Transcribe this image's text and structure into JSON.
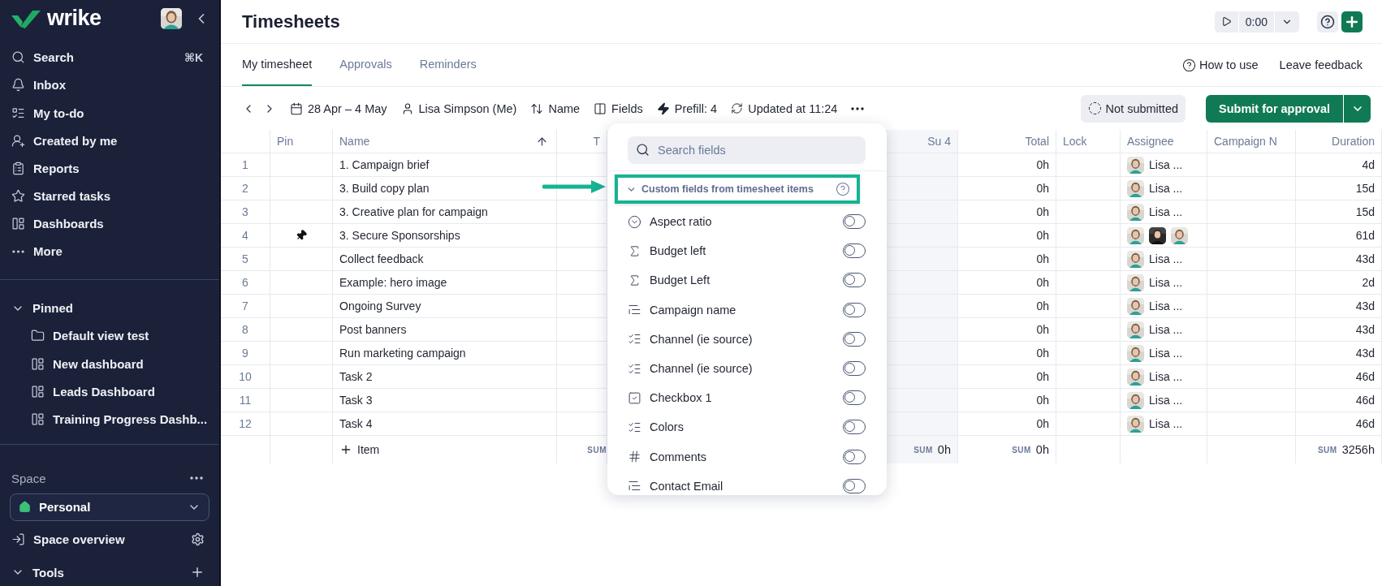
{
  "sidebar": {
    "logo": "wrike",
    "nav": [
      {
        "kind": "search",
        "label": "Search",
        "shortcut": "⌘K"
      },
      {
        "kind": "inbox",
        "label": "Inbox"
      },
      {
        "kind": "todo",
        "label": "My to-do"
      },
      {
        "kind": "created",
        "label": "Created by me"
      },
      {
        "kind": "reports",
        "label": "Reports"
      },
      {
        "kind": "starred",
        "label": "Starred tasks"
      },
      {
        "kind": "dashboards",
        "label": "Dashboards"
      },
      {
        "kind": "more",
        "label": "More"
      }
    ],
    "pinned": {
      "title": "Pinned",
      "expanded": true,
      "items": [
        {
          "kind": "folder",
          "label": "Default view test"
        },
        {
          "kind": "dashboard",
          "label": "New dashboard"
        },
        {
          "kind": "dashboard",
          "label": "Leads Dashboard"
        },
        {
          "kind": "dashboard",
          "label": "Training Progress Dashb..."
        }
      ]
    },
    "space": {
      "title": "Space",
      "selector": "Personal",
      "overview": "Space overview"
    },
    "tools": {
      "title": "Tools",
      "expanded": true
    }
  },
  "header": {
    "title": "Timesheets",
    "timer": "0:00"
  },
  "tabs": [
    {
      "label": "My timesheet",
      "selected": true
    },
    {
      "label": "Approvals",
      "selected": false
    },
    {
      "label": "Reminders",
      "selected": false
    }
  ],
  "tab_links": [
    "How to use",
    "Leave feedback"
  ],
  "toolbar": {
    "period": "28 Apr – 4 May",
    "user": "Lisa Simpson (Me)",
    "sort": "Name",
    "fields": "Fields",
    "prefill": "Prefill: 4",
    "updated": "Updated at 11:24",
    "status": "Not submitted",
    "submit": "Submit for approval"
  },
  "table": {
    "columns": [
      {
        "label": "Pin",
        "sorted": false
      },
      {
        "label": "Name",
        "sorted": true
      },
      {
        "label": "T",
        "sorted": false,
        "sum_label": "SUM"
      },
      {
        "label": "Su 4",
        "sorted": false,
        "sum_label": "SUM",
        "sum": "0h"
      },
      {
        "label": "Total",
        "sorted": false,
        "sum_label": "SUM",
        "sum": "0h"
      },
      {
        "label": "Lock",
        "sorted": false
      },
      {
        "label": "Assignee",
        "sorted": false
      },
      {
        "label": "Campaign N",
        "sorted": false
      },
      {
        "label": "Duration",
        "sorted": false,
        "sum_label": "SUM",
        "sum": "3256h"
      }
    ],
    "rows": [
      {
        "num": "1",
        "pinned": false,
        "name": "1. Campaign brief",
        "total": "0h",
        "assignee_label": "Lisa ...",
        "duration": "4d"
      },
      {
        "num": "2",
        "pinned": false,
        "name": "3. Build copy plan",
        "total": "0h",
        "assignee_label": "Lisa ...",
        "duration": "15d"
      },
      {
        "num": "3",
        "pinned": false,
        "name": "3. Creative plan for campaign",
        "total": "0h",
        "assignee_label": "Lisa ...",
        "duration": "15d"
      },
      {
        "num": "4",
        "pinned": true,
        "name": "3. Secure Sponsorships",
        "total": "0h",
        "duration": "61d"
      },
      {
        "num": "5",
        "pinned": false,
        "name": "Collect feedback",
        "total": "0h",
        "assignee_label": "Lisa ...",
        "duration": "43d"
      },
      {
        "num": "6",
        "pinned": false,
        "name": "Example: hero image",
        "total": "0h",
        "assignee_label": "Lisa ...",
        "duration": "2d"
      },
      {
        "num": "7",
        "pinned": false,
        "name": "Ongoing Survey",
        "total": "0h",
        "assignee_label": "Lisa ...",
        "duration": "43d"
      },
      {
        "num": "8",
        "pinned": false,
        "name": "Post banners",
        "total": "0h",
        "assignee_label": "Lisa ...",
        "duration": "43d"
      },
      {
        "num": "9",
        "pinned": false,
        "name": "Run marketing campaign",
        "total": "0h",
        "assignee_label": "Lisa ...",
        "duration": "43d"
      },
      {
        "num": "10",
        "pinned": false,
        "name": "Task 2",
        "total": "0h",
        "assignee_label": "Lisa ...",
        "duration": "46d"
      },
      {
        "num": "11",
        "pinned": false,
        "name": "Task 3",
        "total": "0h",
        "assignee_label": "Lisa ...",
        "duration": "46d"
      },
      {
        "num": "12",
        "pinned": false,
        "name": "Task 4",
        "total": "0h",
        "assignee_label": "Lisa ...",
        "duration": "46d"
      }
    ],
    "add_item": "Item"
  },
  "fields_popup": {
    "search": {
      "placeholder": "Search fields"
    },
    "group": {
      "title": "Custom fields from timesheet items",
      "expanded": true
    },
    "items": [
      {
        "kind": "dropdown",
        "label": "Aspect ratio",
        "on": false
      },
      {
        "kind": "formula",
        "label": "Budget left",
        "on": false
      },
      {
        "kind": "formula",
        "label": "Budget Left",
        "on": false
      },
      {
        "kind": "text",
        "label": "Campaign name",
        "on": false
      },
      {
        "kind": "multiselect",
        "label": "Channel (ie source)",
        "on": false
      },
      {
        "kind": "multiselect",
        "label": "Channel (ie source)",
        "on": false
      },
      {
        "kind": "checkbox",
        "label": "Checkbox 1",
        "on": false
      },
      {
        "kind": "multiselect",
        "label": "Colors",
        "on": false
      },
      {
        "kind": "number",
        "label": "Comments",
        "on": false
      },
      {
        "kind": "text",
        "label": "Contact Email",
        "on": false
      }
    ]
  }
}
